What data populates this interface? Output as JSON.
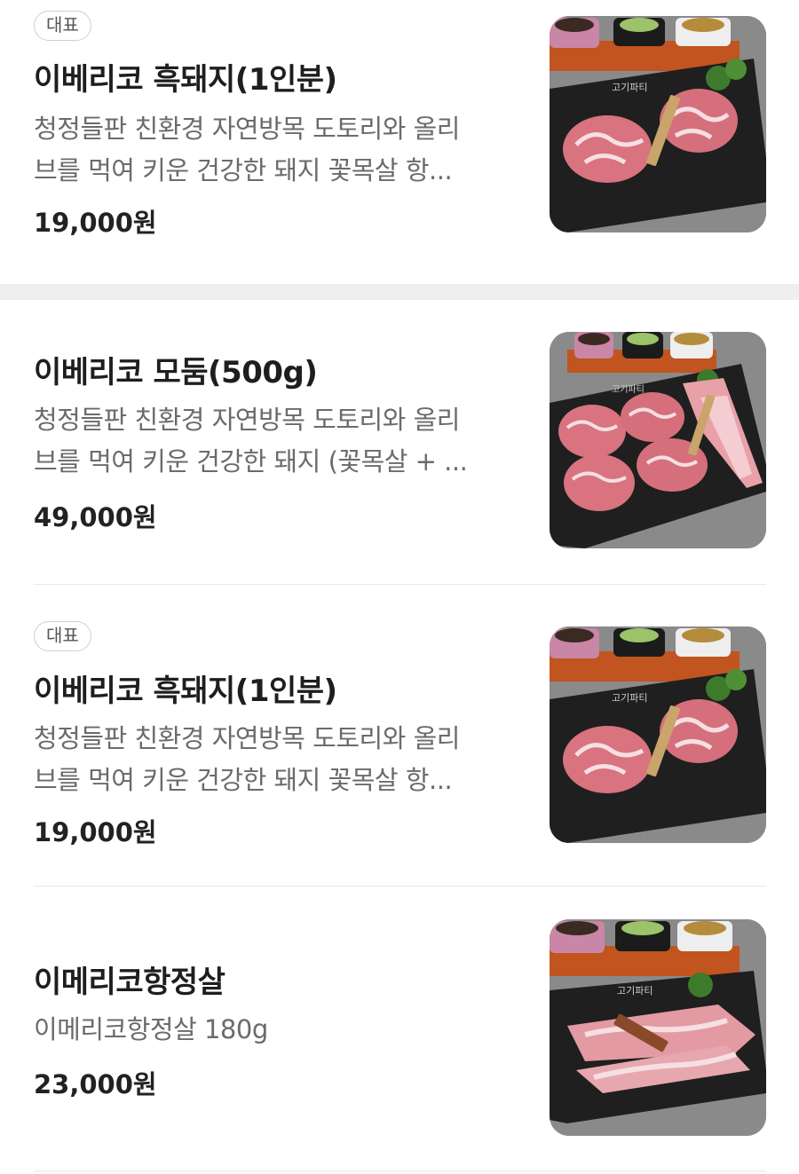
{
  "menu": {
    "items": [
      {
        "badge": "대표",
        "title": "이베리코 흑돼지(1인분)",
        "desc_lines": [
          "청정들판 친환경 자연방목 도토리와 올리",
          "브를 먹여 키운 건강한 돼지 꽃목살 항..."
        ],
        "price": "19,000원",
        "image": "pork-neck-two-steaks-photo"
      },
      {
        "badge": "",
        "title": "이베리코 모둠(500g)",
        "desc_lines": [
          "청정들판 친환경 자연방목 도토리와 올리",
          "브를 먹여 키운 건강한 돼지 (꽃목살 + ..."
        ],
        "price": "49,000원",
        "image": "assorted-pork-platter-photo"
      },
      {
        "badge": "대표",
        "title": "이베리코 흑돼지(1인분)",
        "desc_lines": [
          "청정들판 친환경 자연방목 도토리와 올리",
          "브를 먹여 키운 건강한 돼지 꽃목살 항..."
        ],
        "price": "19,000원",
        "image": "pork-neck-two-steaks-photo"
      },
      {
        "badge": "",
        "title": "이메리코항정살",
        "desc_lines": [
          "이메리코항정살 180g"
        ],
        "price": "23,000원",
        "image": "pork-jowl-strips-photo"
      }
    ]
  },
  "colors": {
    "meat": "#d9737f",
    "marble": "#f5dfe2",
    "board": "#1f1f1f",
    "tray": "#c2541f",
    "herb": "#3e7a2c",
    "background": "#8a8a8a"
  }
}
